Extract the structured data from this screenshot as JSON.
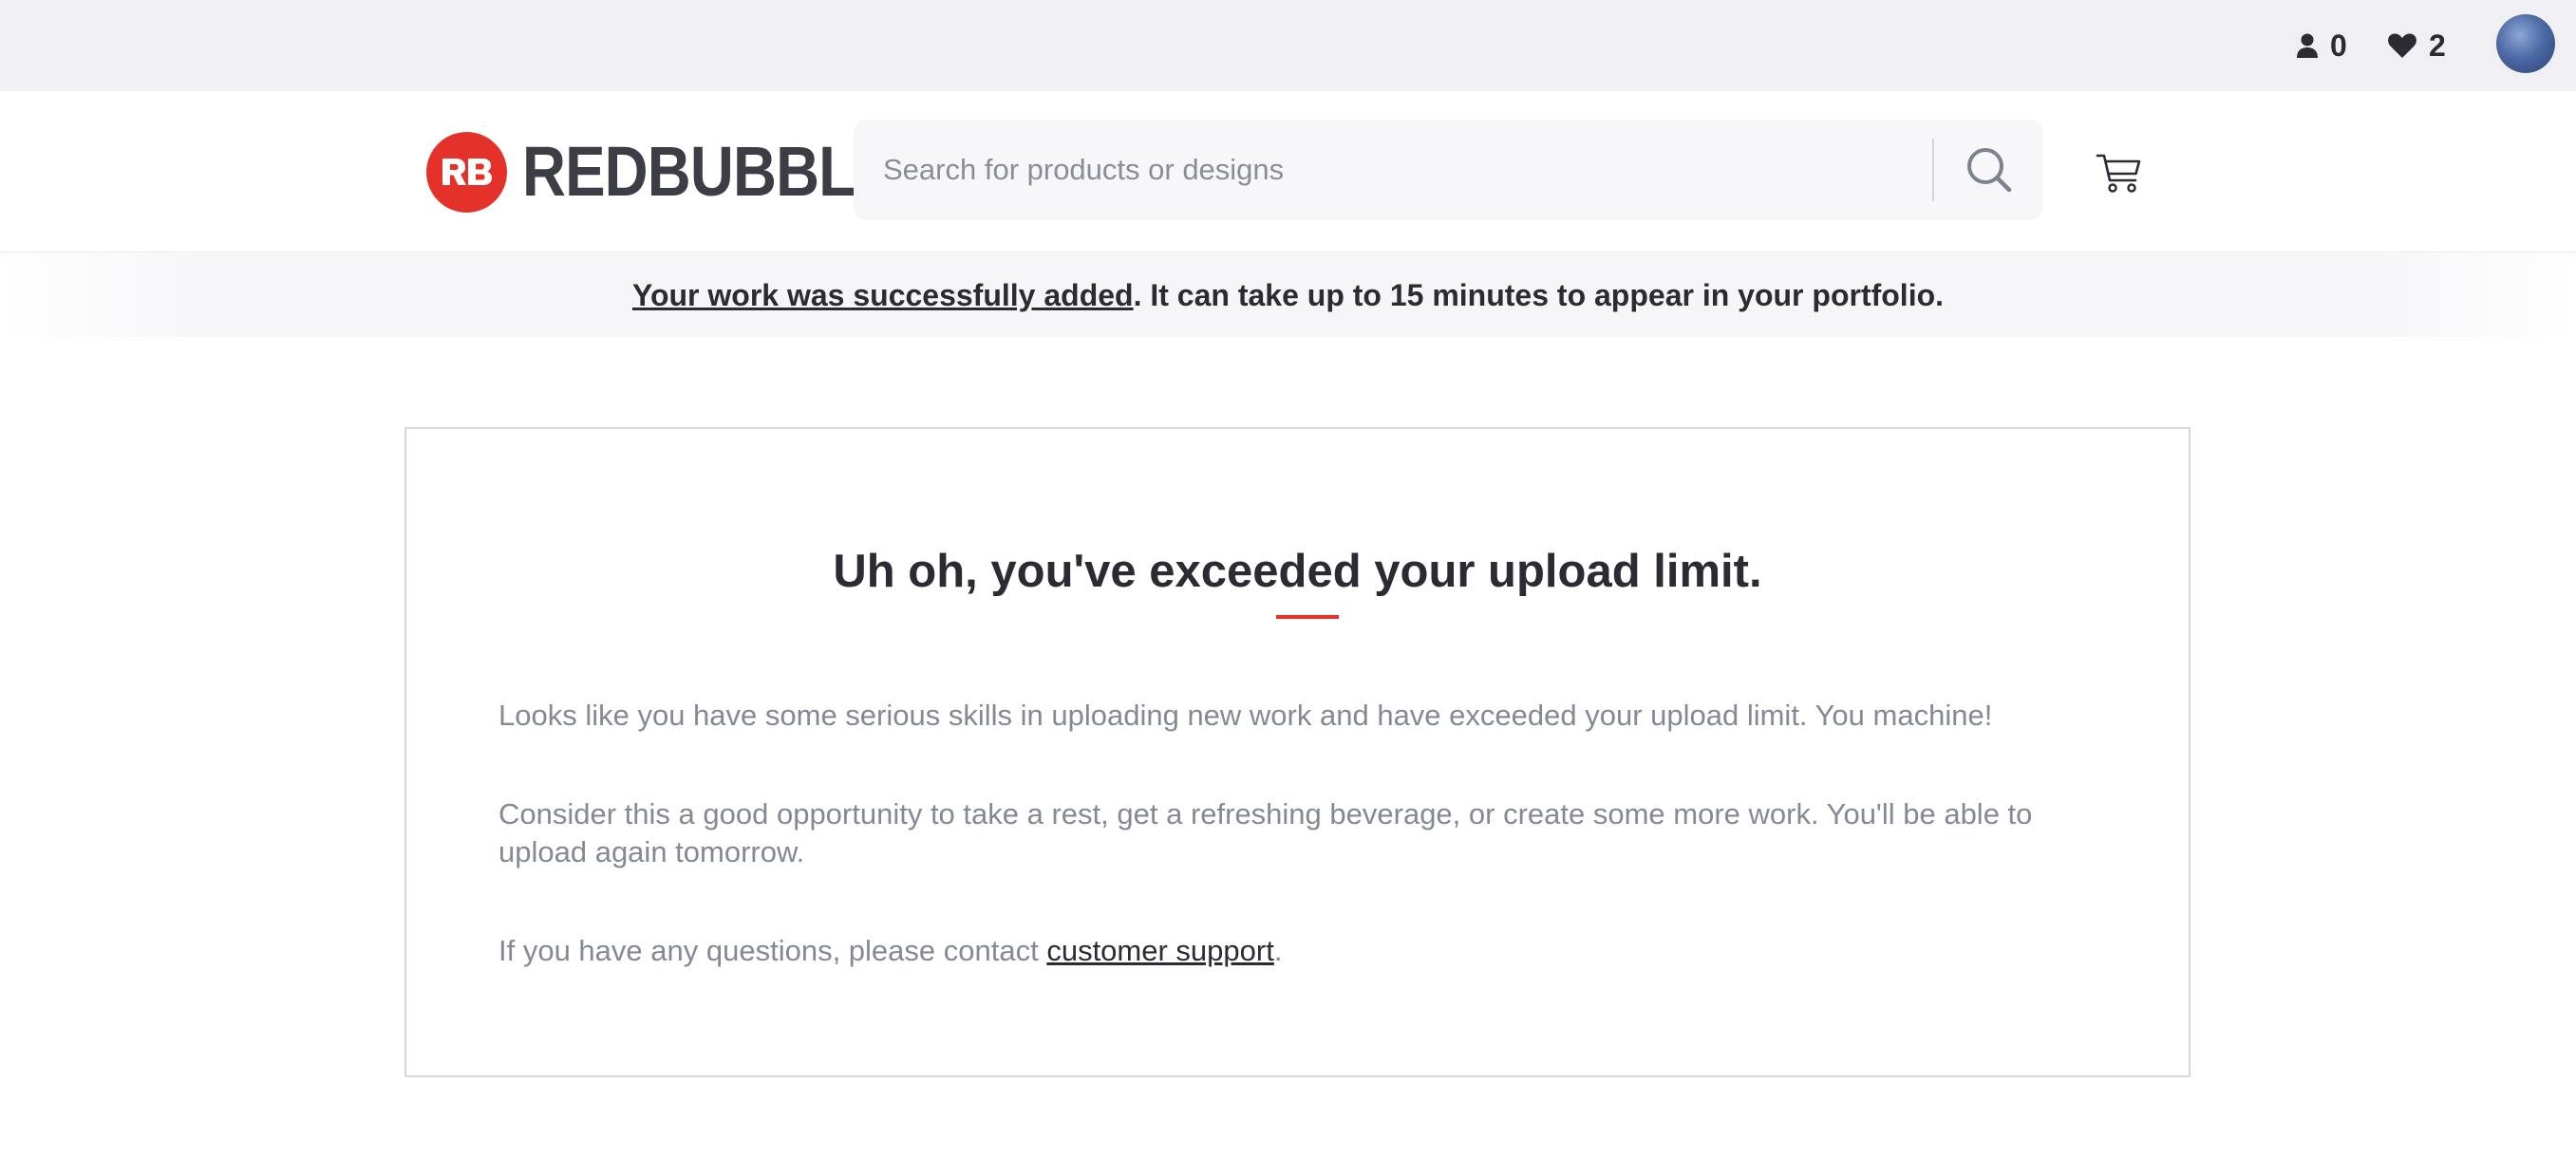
{
  "topbar": {
    "followers_count": "0",
    "favorites_count": "2",
    "icons": {
      "followers": "person-icon",
      "favorites": "heart-icon"
    }
  },
  "header": {
    "logo_text": "REDBUBBLE",
    "logo_badge": "RB",
    "search": {
      "placeholder": "Search for products or designs",
      "value": ""
    },
    "icons": {
      "search": "magnifier-icon",
      "cart": "shopping-cart-icon"
    }
  },
  "notice": {
    "link_text": "Your work was successfully added",
    "rest_text": ". It can take up to 15 minutes to appear in your portfolio."
  },
  "card": {
    "title": "Uh oh, you've exceeded your upload limit.",
    "paragraph1": "Looks like you have some serious skills in uploading new work and have exceeded your upload limit. You machine!",
    "paragraph2": "Consider this a good opportunity to take a rest, get a refreshing beverage, or create some more work. You'll be able to upload again tomorrow.",
    "paragraph3_prefix": "If you have any questions, please contact ",
    "paragraph3_link": "customer support",
    "paragraph3_suffix": "."
  },
  "colors": {
    "brand_red": "#e4322b",
    "text_dark": "#2b2b33",
    "text_muted": "#858996",
    "topbar_bg": "#f0f0f4"
  }
}
